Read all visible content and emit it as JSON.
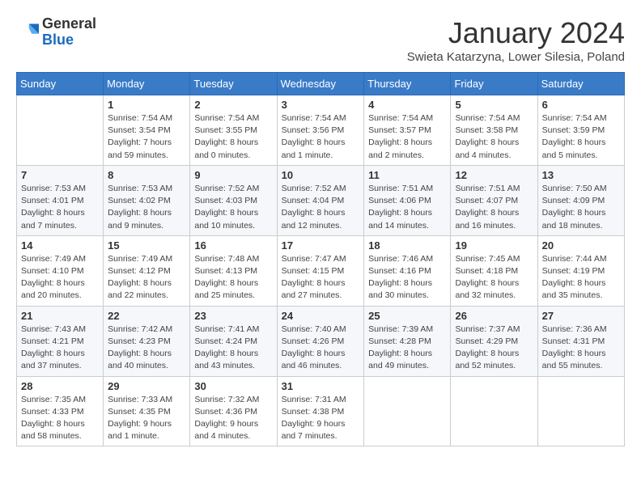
{
  "header": {
    "logo": {
      "general": "General",
      "blue": "Blue"
    },
    "title": "January 2024",
    "location": "Swieta Katarzyna, Lower Silesia, Poland"
  },
  "weekdays": [
    "Sunday",
    "Monday",
    "Tuesday",
    "Wednesday",
    "Thursday",
    "Friday",
    "Saturday"
  ],
  "weeks": [
    [
      {
        "day": "",
        "info": ""
      },
      {
        "day": "1",
        "info": "Sunrise: 7:54 AM\nSunset: 3:54 PM\nDaylight: 7 hours\nand 59 minutes."
      },
      {
        "day": "2",
        "info": "Sunrise: 7:54 AM\nSunset: 3:55 PM\nDaylight: 8 hours\nand 0 minutes."
      },
      {
        "day": "3",
        "info": "Sunrise: 7:54 AM\nSunset: 3:56 PM\nDaylight: 8 hours\nand 1 minute."
      },
      {
        "day": "4",
        "info": "Sunrise: 7:54 AM\nSunset: 3:57 PM\nDaylight: 8 hours\nand 2 minutes."
      },
      {
        "day": "5",
        "info": "Sunrise: 7:54 AM\nSunset: 3:58 PM\nDaylight: 8 hours\nand 4 minutes."
      },
      {
        "day": "6",
        "info": "Sunrise: 7:54 AM\nSunset: 3:59 PM\nDaylight: 8 hours\nand 5 minutes."
      }
    ],
    [
      {
        "day": "7",
        "info": "Sunrise: 7:53 AM\nSunset: 4:01 PM\nDaylight: 8 hours\nand 7 minutes."
      },
      {
        "day": "8",
        "info": "Sunrise: 7:53 AM\nSunset: 4:02 PM\nDaylight: 8 hours\nand 9 minutes."
      },
      {
        "day": "9",
        "info": "Sunrise: 7:52 AM\nSunset: 4:03 PM\nDaylight: 8 hours\nand 10 minutes."
      },
      {
        "day": "10",
        "info": "Sunrise: 7:52 AM\nSunset: 4:04 PM\nDaylight: 8 hours\nand 12 minutes."
      },
      {
        "day": "11",
        "info": "Sunrise: 7:51 AM\nSunset: 4:06 PM\nDaylight: 8 hours\nand 14 minutes."
      },
      {
        "day": "12",
        "info": "Sunrise: 7:51 AM\nSunset: 4:07 PM\nDaylight: 8 hours\nand 16 minutes."
      },
      {
        "day": "13",
        "info": "Sunrise: 7:50 AM\nSunset: 4:09 PM\nDaylight: 8 hours\nand 18 minutes."
      }
    ],
    [
      {
        "day": "14",
        "info": "Sunrise: 7:49 AM\nSunset: 4:10 PM\nDaylight: 8 hours\nand 20 minutes."
      },
      {
        "day": "15",
        "info": "Sunrise: 7:49 AM\nSunset: 4:12 PM\nDaylight: 8 hours\nand 22 minutes."
      },
      {
        "day": "16",
        "info": "Sunrise: 7:48 AM\nSunset: 4:13 PM\nDaylight: 8 hours\nand 25 minutes."
      },
      {
        "day": "17",
        "info": "Sunrise: 7:47 AM\nSunset: 4:15 PM\nDaylight: 8 hours\nand 27 minutes."
      },
      {
        "day": "18",
        "info": "Sunrise: 7:46 AM\nSunset: 4:16 PM\nDaylight: 8 hours\nand 30 minutes."
      },
      {
        "day": "19",
        "info": "Sunrise: 7:45 AM\nSunset: 4:18 PM\nDaylight: 8 hours\nand 32 minutes."
      },
      {
        "day": "20",
        "info": "Sunrise: 7:44 AM\nSunset: 4:19 PM\nDaylight: 8 hours\nand 35 minutes."
      }
    ],
    [
      {
        "day": "21",
        "info": "Sunrise: 7:43 AM\nSunset: 4:21 PM\nDaylight: 8 hours\nand 37 minutes."
      },
      {
        "day": "22",
        "info": "Sunrise: 7:42 AM\nSunset: 4:23 PM\nDaylight: 8 hours\nand 40 minutes."
      },
      {
        "day": "23",
        "info": "Sunrise: 7:41 AM\nSunset: 4:24 PM\nDaylight: 8 hours\nand 43 minutes."
      },
      {
        "day": "24",
        "info": "Sunrise: 7:40 AM\nSunset: 4:26 PM\nDaylight: 8 hours\nand 46 minutes."
      },
      {
        "day": "25",
        "info": "Sunrise: 7:39 AM\nSunset: 4:28 PM\nDaylight: 8 hours\nand 49 minutes."
      },
      {
        "day": "26",
        "info": "Sunrise: 7:37 AM\nSunset: 4:29 PM\nDaylight: 8 hours\nand 52 minutes."
      },
      {
        "day": "27",
        "info": "Sunrise: 7:36 AM\nSunset: 4:31 PM\nDaylight: 8 hours\nand 55 minutes."
      }
    ],
    [
      {
        "day": "28",
        "info": "Sunrise: 7:35 AM\nSunset: 4:33 PM\nDaylight: 8 hours\nand 58 minutes."
      },
      {
        "day": "29",
        "info": "Sunrise: 7:33 AM\nSunset: 4:35 PM\nDaylight: 9 hours\nand 1 minute."
      },
      {
        "day": "30",
        "info": "Sunrise: 7:32 AM\nSunset: 4:36 PM\nDaylight: 9 hours\nand 4 minutes."
      },
      {
        "day": "31",
        "info": "Sunrise: 7:31 AM\nSunset: 4:38 PM\nDaylight: 9 hours\nand 7 minutes."
      },
      {
        "day": "",
        "info": ""
      },
      {
        "day": "",
        "info": ""
      },
      {
        "day": "",
        "info": ""
      }
    ]
  ]
}
